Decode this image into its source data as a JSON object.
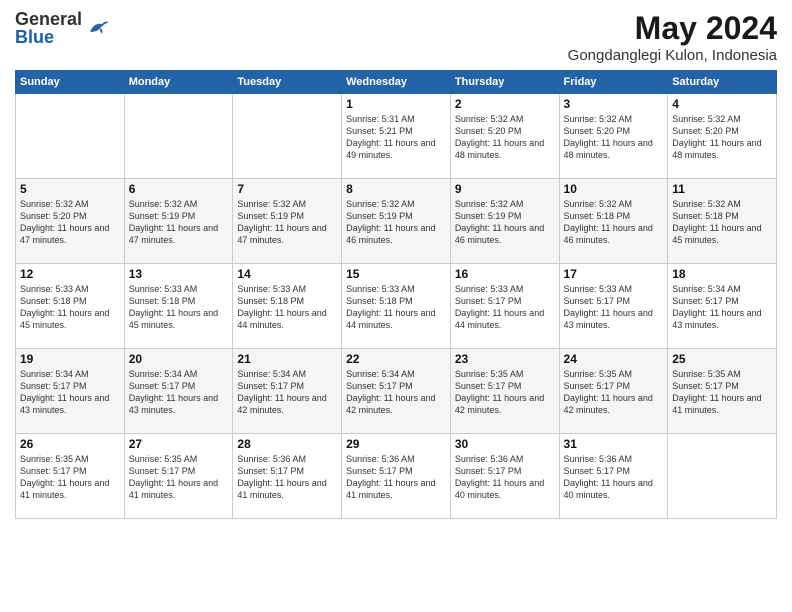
{
  "header": {
    "logo_general": "General",
    "logo_blue": "Blue",
    "title": "May 2024",
    "location": "Gongdanglegi Kulon, Indonesia"
  },
  "weekdays": [
    "Sunday",
    "Monday",
    "Tuesday",
    "Wednesday",
    "Thursday",
    "Friday",
    "Saturday"
  ],
  "weeks": [
    [
      {
        "day": "",
        "info": ""
      },
      {
        "day": "",
        "info": ""
      },
      {
        "day": "",
        "info": ""
      },
      {
        "day": "1",
        "info": "Sunrise: 5:31 AM\nSunset: 5:21 PM\nDaylight: 11 hours\nand 49 minutes."
      },
      {
        "day": "2",
        "info": "Sunrise: 5:32 AM\nSunset: 5:20 PM\nDaylight: 11 hours\nand 48 minutes."
      },
      {
        "day": "3",
        "info": "Sunrise: 5:32 AM\nSunset: 5:20 PM\nDaylight: 11 hours\nand 48 minutes."
      },
      {
        "day": "4",
        "info": "Sunrise: 5:32 AM\nSunset: 5:20 PM\nDaylight: 11 hours\nand 48 minutes."
      }
    ],
    [
      {
        "day": "5",
        "info": "Sunrise: 5:32 AM\nSunset: 5:20 PM\nDaylight: 11 hours\nand 47 minutes."
      },
      {
        "day": "6",
        "info": "Sunrise: 5:32 AM\nSunset: 5:19 PM\nDaylight: 11 hours\nand 47 minutes."
      },
      {
        "day": "7",
        "info": "Sunrise: 5:32 AM\nSunset: 5:19 PM\nDaylight: 11 hours\nand 47 minutes."
      },
      {
        "day": "8",
        "info": "Sunrise: 5:32 AM\nSunset: 5:19 PM\nDaylight: 11 hours\nand 46 minutes."
      },
      {
        "day": "9",
        "info": "Sunrise: 5:32 AM\nSunset: 5:19 PM\nDaylight: 11 hours\nand 46 minutes."
      },
      {
        "day": "10",
        "info": "Sunrise: 5:32 AM\nSunset: 5:18 PM\nDaylight: 11 hours\nand 46 minutes."
      },
      {
        "day": "11",
        "info": "Sunrise: 5:32 AM\nSunset: 5:18 PM\nDaylight: 11 hours\nand 45 minutes."
      }
    ],
    [
      {
        "day": "12",
        "info": "Sunrise: 5:33 AM\nSunset: 5:18 PM\nDaylight: 11 hours\nand 45 minutes."
      },
      {
        "day": "13",
        "info": "Sunrise: 5:33 AM\nSunset: 5:18 PM\nDaylight: 11 hours\nand 45 minutes."
      },
      {
        "day": "14",
        "info": "Sunrise: 5:33 AM\nSunset: 5:18 PM\nDaylight: 11 hours\nand 44 minutes."
      },
      {
        "day": "15",
        "info": "Sunrise: 5:33 AM\nSunset: 5:18 PM\nDaylight: 11 hours\nand 44 minutes."
      },
      {
        "day": "16",
        "info": "Sunrise: 5:33 AM\nSunset: 5:17 PM\nDaylight: 11 hours\nand 44 minutes."
      },
      {
        "day": "17",
        "info": "Sunrise: 5:33 AM\nSunset: 5:17 PM\nDaylight: 11 hours\nand 43 minutes."
      },
      {
        "day": "18",
        "info": "Sunrise: 5:34 AM\nSunset: 5:17 PM\nDaylight: 11 hours\nand 43 minutes."
      }
    ],
    [
      {
        "day": "19",
        "info": "Sunrise: 5:34 AM\nSunset: 5:17 PM\nDaylight: 11 hours\nand 43 minutes."
      },
      {
        "day": "20",
        "info": "Sunrise: 5:34 AM\nSunset: 5:17 PM\nDaylight: 11 hours\nand 43 minutes."
      },
      {
        "day": "21",
        "info": "Sunrise: 5:34 AM\nSunset: 5:17 PM\nDaylight: 11 hours\nand 42 minutes."
      },
      {
        "day": "22",
        "info": "Sunrise: 5:34 AM\nSunset: 5:17 PM\nDaylight: 11 hours\nand 42 minutes."
      },
      {
        "day": "23",
        "info": "Sunrise: 5:35 AM\nSunset: 5:17 PM\nDaylight: 11 hours\nand 42 minutes."
      },
      {
        "day": "24",
        "info": "Sunrise: 5:35 AM\nSunset: 5:17 PM\nDaylight: 11 hours\nand 42 minutes."
      },
      {
        "day": "25",
        "info": "Sunrise: 5:35 AM\nSunset: 5:17 PM\nDaylight: 11 hours\nand 41 minutes."
      }
    ],
    [
      {
        "day": "26",
        "info": "Sunrise: 5:35 AM\nSunset: 5:17 PM\nDaylight: 11 hours\nand 41 minutes."
      },
      {
        "day": "27",
        "info": "Sunrise: 5:35 AM\nSunset: 5:17 PM\nDaylight: 11 hours\nand 41 minutes."
      },
      {
        "day": "28",
        "info": "Sunrise: 5:36 AM\nSunset: 5:17 PM\nDaylight: 11 hours\nand 41 minutes."
      },
      {
        "day": "29",
        "info": "Sunrise: 5:36 AM\nSunset: 5:17 PM\nDaylight: 11 hours\nand 41 minutes."
      },
      {
        "day": "30",
        "info": "Sunrise: 5:36 AM\nSunset: 5:17 PM\nDaylight: 11 hours\nand 40 minutes."
      },
      {
        "day": "31",
        "info": "Sunrise: 5:36 AM\nSunset: 5:17 PM\nDaylight: 11 hours\nand 40 minutes."
      },
      {
        "day": "",
        "info": ""
      }
    ]
  ]
}
